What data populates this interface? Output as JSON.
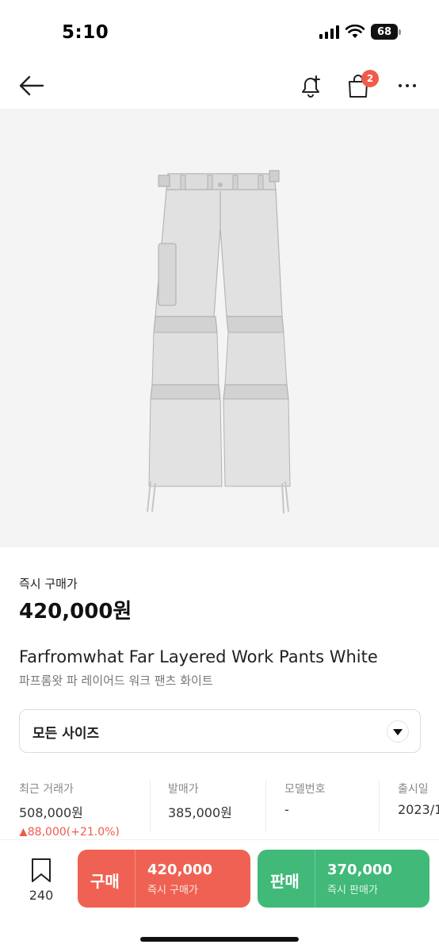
{
  "status_bar": {
    "time": "5:10",
    "battery": "68"
  },
  "nav": {
    "cart_badge": "2"
  },
  "price": {
    "label": "즉시 구매가",
    "value": "420,000원"
  },
  "product": {
    "name": "Farfromwhat Far Layered Work Pants White",
    "name_ko": "파프롬왓 파 레이어드 워크 팬츠 화이트"
  },
  "size_select": {
    "label": "모든 사이즈"
  },
  "info": [
    {
      "label": "최근 거래가",
      "value": "508,000원",
      "change": "▲88,000(+21.0%)"
    },
    {
      "label": "발매가",
      "value": "385,000원"
    },
    {
      "label": "모델번호",
      "value": "-"
    },
    {
      "label": "출시일",
      "value": "2023/1"
    }
  ],
  "bottom": {
    "wish_count": "240",
    "buy": {
      "label": "구매",
      "price": "420,000",
      "sub": "즉시 구매가"
    },
    "sell": {
      "label": "판매",
      "price": "370,000",
      "sub": "즉시 판매가"
    }
  },
  "colors": {
    "buy": "#ef6253",
    "sell": "#41b979",
    "badge": "#ef5b4b",
    "change": "#ef5b4b"
  }
}
